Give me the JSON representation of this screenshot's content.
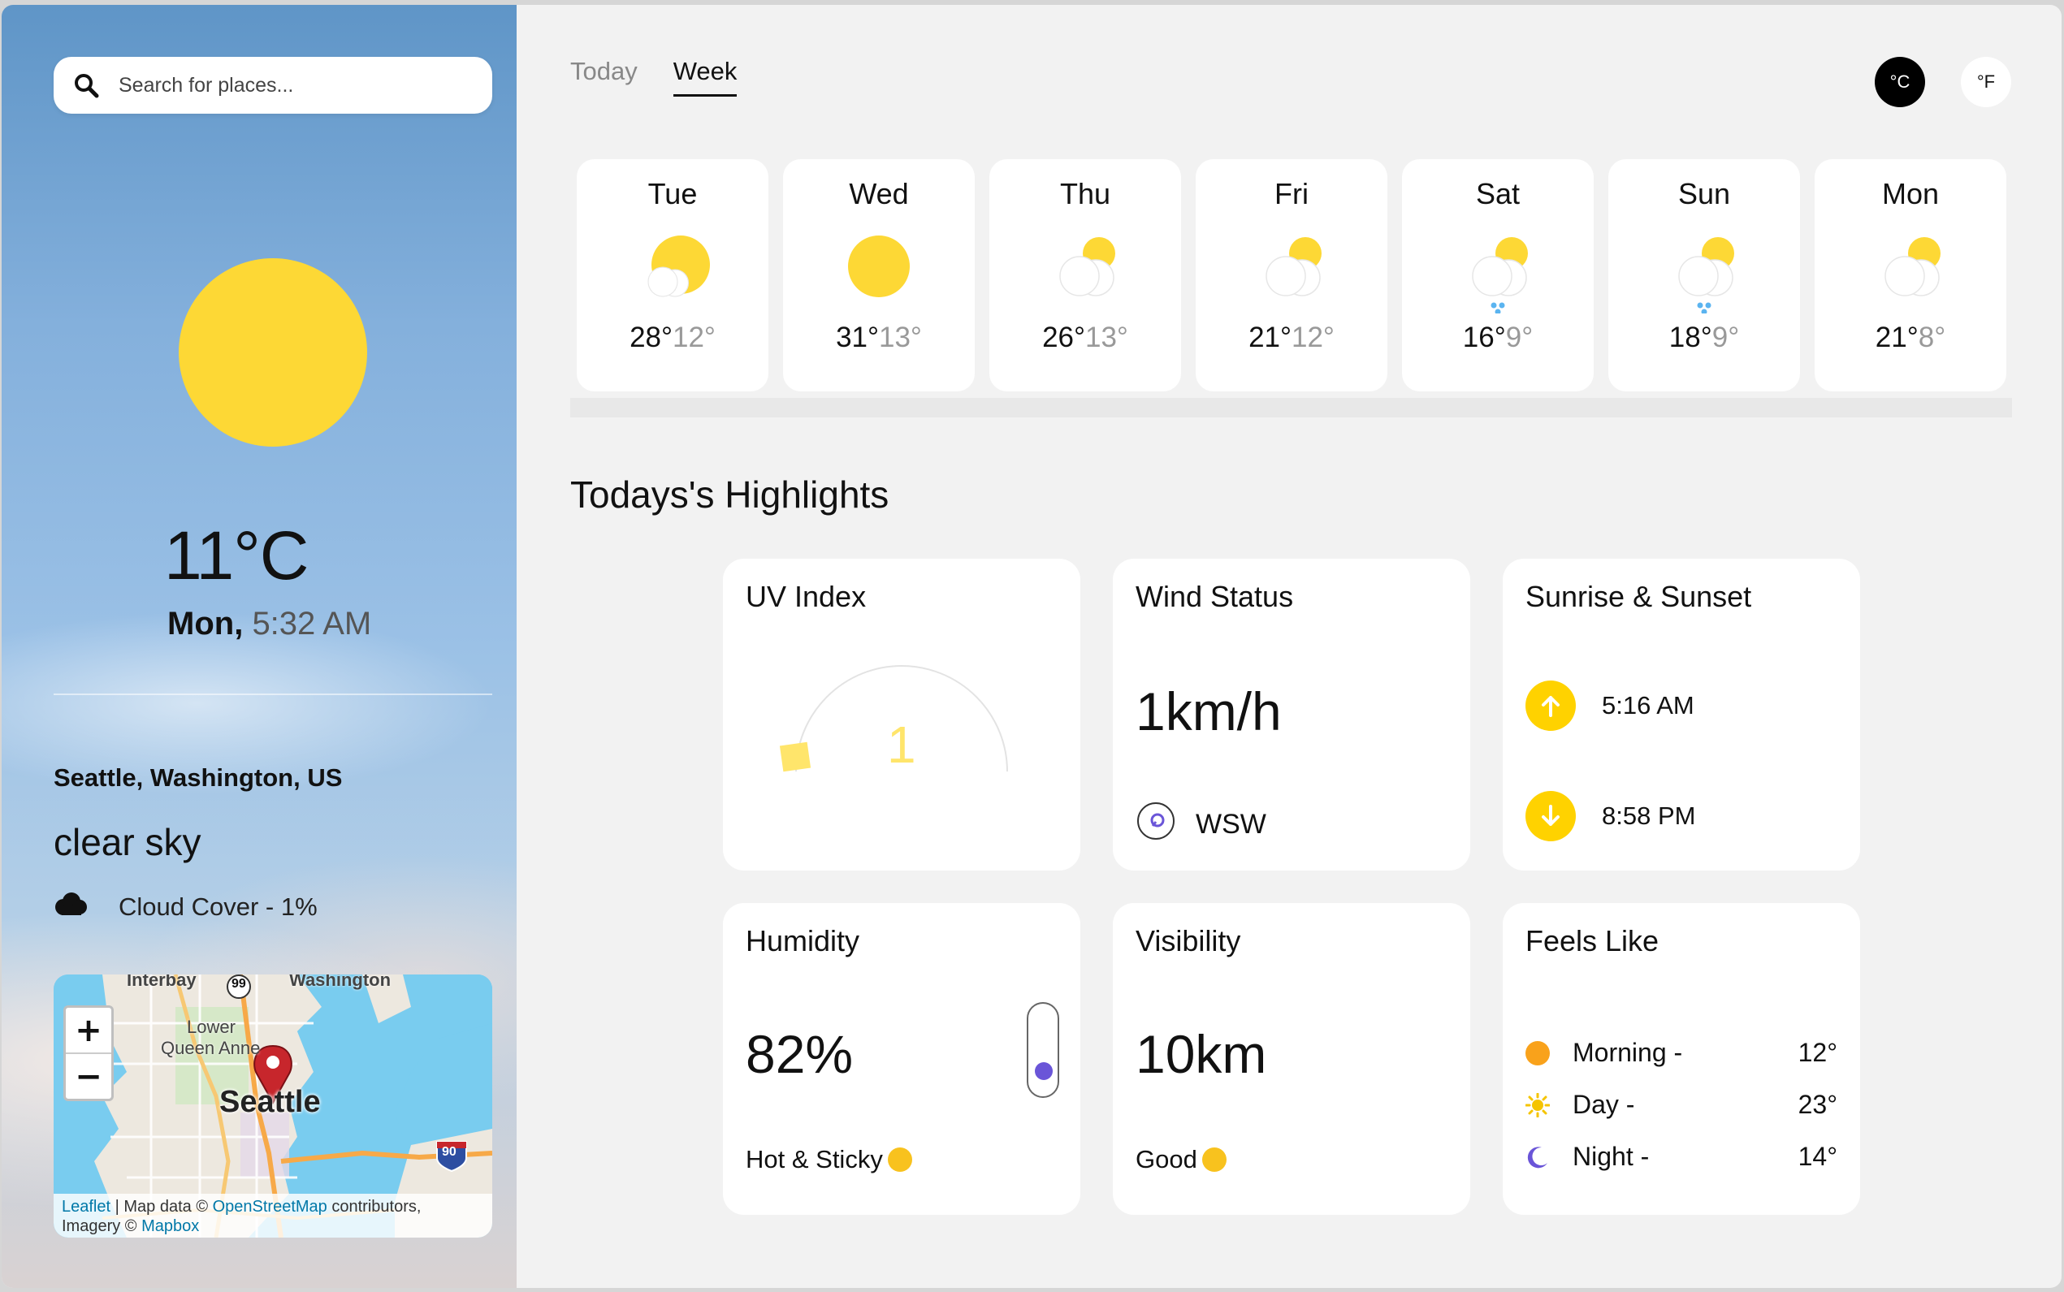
{
  "search": {
    "placeholder": "Search for places..."
  },
  "current": {
    "temperature": "11°C",
    "day": "Mon,",
    "time": "5:32 AM",
    "location": "Seattle, Washington, US",
    "condition": "clear sky",
    "cloud_cover": "Cloud Cover - 1%"
  },
  "map": {
    "zoom_in": "+",
    "zoom_out": "−",
    "city_label": "Seattle",
    "label_lower_queen_anne_1": "Lower",
    "label_lower_queen_anne_2": "Queen Anne",
    "label_interbay": "Interbay",
    "label_washington": "Washington",
    "label_highway_99": "99",
    "label_highway_90": "90",
    "attribution": {
      "leaflet": "Leaflet",
      "sep1": " | Map data © ",
      "osm": "OpenStreetMap",
      "contributors": " contributors,",
      "imagery": "Imagery © ",
      "mapbox": "Mapbox"
    }
  },
  "tabs": {
    "today": "Today",
    "week": "Week",
    "active": "Week"
  },
  "units": {
    "celsius": "°C",
    "fahrenheit": "°F",
    "active": "°C"
  },
  "week": [
    {
      "day": "Tue",
      "high": "28°",
      "low": "12°",
      "icon": "sun-cloud-icon"
    },
    {
      "day": "Wed",
      "high": "31°",
      "low": "13°",
      "icon": "sun-icon"
    },
    {
      "day": "Thu",
      "high": "26°",
      "low": "13°",
      "icon": "cloud-sun-icon"
    },
    {
      "day": "Fri",
      "high": "21°",
      "low": "12°",
      "icon": "cloud-sun-icon"
    },
    {
      "day": "Sat",
      "high": "16°",
      "low": "9°",
      "icon": "cloud-sun-rain-icon"
    },
    {
      "day": "Sun",
      "high": "18°",
      "low": "9°",
      "icon": "cloud-sun-rain-icon"
    },
    {
      "day": "Mon",
      "high": "21°",
      "low": "8°",
      "icon": "cloud-sun-icon"
    }
  ],
  "highlights": {
    "title": "Todays's Highlights",
    "uv": {
      "title": "UV Index",
      "value": "1",
      "level": 1
    },
    "wind": {
      "title": "Wind Status",
      "value": "1km/h",
      "direction": "WSW"
    },
    "sun": {
      "title": "Sunrise & Sunset",
      "sunrise": "5:16 AM",
      "sunset": "8:58 PM"
    },
    "humidity": {
      "title": "Humidity",
      "value": "82%",
      "note": "Hot & Sticky",
      "level": 0.82
    },
    "visibility": {
      "title": "Visibility",
      "value": "10km",
      "note": "Good"
    },
    "feels_like": {
      "title": "Feels Like",
      "morning_label": "Morning -",
      "morning": "12°",
      "day_label": "Day -",
      "day": "23°",
      "night_label": "Night -",
      "night": "14°"
    }
  },
  "colors": {
    "sun": "#fdd835",
    "accent_purple": "#6a55d8",
    "sunrise_yellow": "#ffd200",
    "morning_orange": "#f9a21b"
  }
}
